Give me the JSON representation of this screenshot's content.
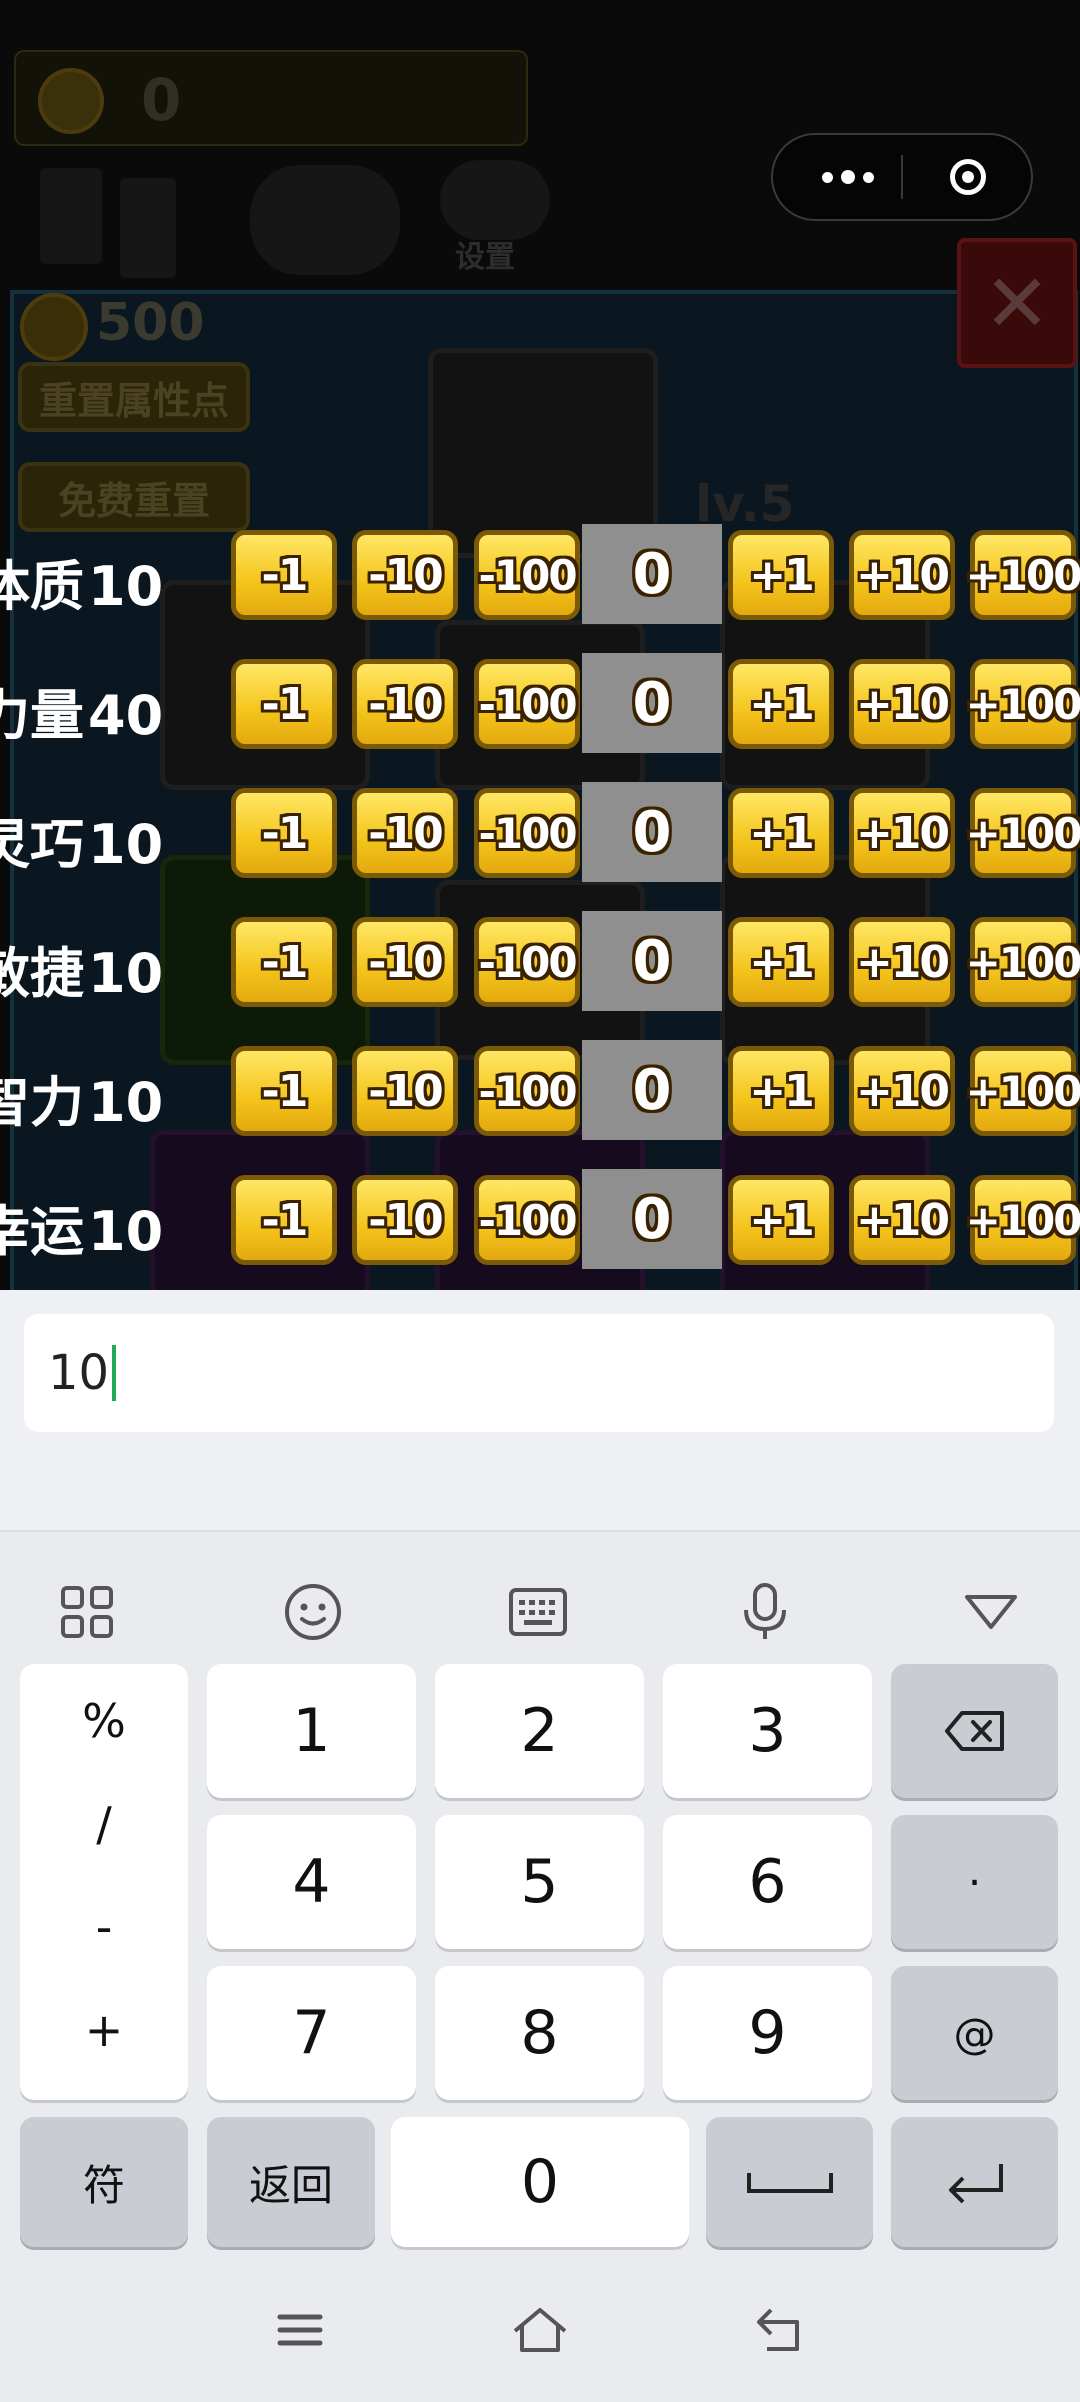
{
  "game": {
    "coin_count": "0",
    "settings_label": "设置",
    "panel_coins": "500",
    "reset_attr_label": "重置属性点",
    "free_reset_label": "免费重置",
    "level_label": "lv.5",
    "close_label": "✕"
  },
  "stats": [
    {
      "name": "体质",
      "value": "10",
      "input": "0"
    },
    {
      "name": "力量",
      "value": "40",
      "input": "0"
    },
    {
      "name": "灵巧",
      "value": "10",
      "input": "0"
    },
    {
      "name": "敏捷",
      "value": "10",
      "input": "0"
    },
    {
      "name": "智力",
      "value": "10",
      "input": "0"
    },
    {
      "name": "幸运",
      "value": "10",
      "input": "0"
    }
  ],
  "stat_buttons": [
    "-1",
    "-10",
    "-100",
    "+1",
    "+10",
    "+100"
  ],
  "input": {
    "value": "10"
  },
  "keyboard": {
    "symbols": [
      "%",
      "/",
      "-",
      "+"
    ],
    "digits": [
      "1",
      "2",
      "3",
      "4",
      "5",
      "6",
      "7",
      "8",
      "9",
      "0"
    ],
    "dot": "·",
    "at": "@",
    "fu": "符",
    "back": "返回"
  }
}
